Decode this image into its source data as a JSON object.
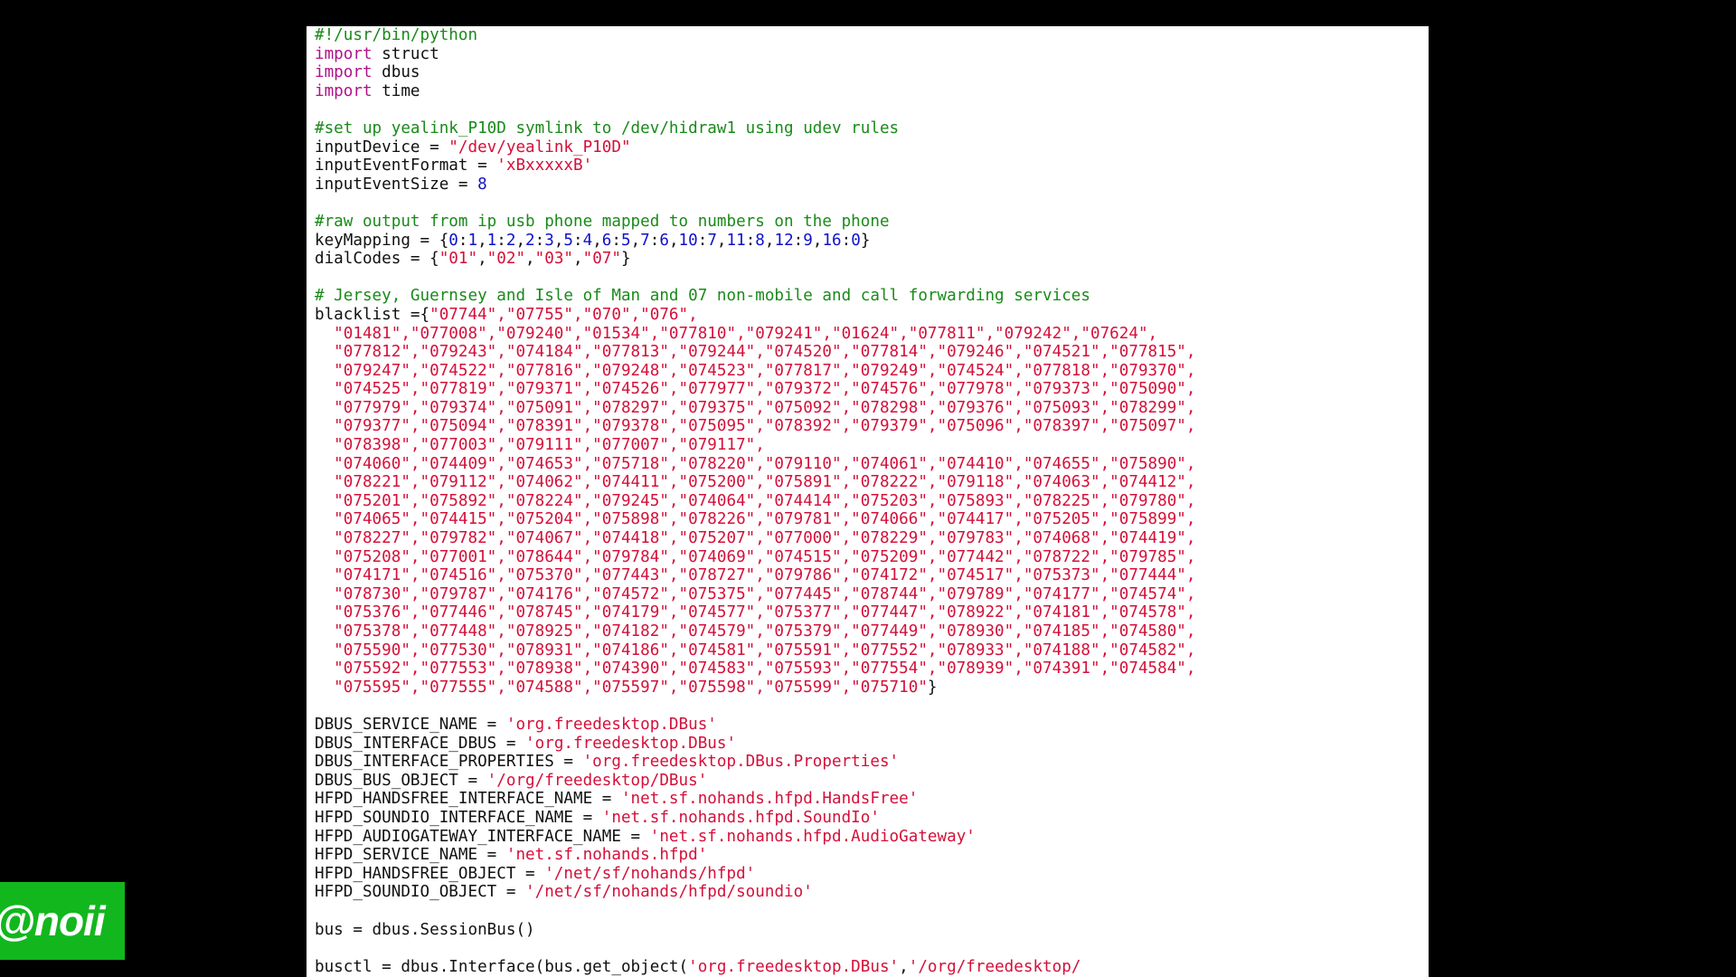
{
  "colors": {
    "background": "#000000",
    "editor_background": "#ffffff",
    "comment": "#1a8a1a",
    "keyword": "#b0128a",
    "string": "#d4103a",
    "number": "#1111c8",
    "plain": "#111111",
    "watermark_background": "#12b71e"
  },
  "watermark": {
    "text": "@noii"
  },
  "editor": {
    "language": "python",
    "lines": [
      [
        {
          "t": "comment",
          "v": "#!/usr/bin/python"
        }
      ],
      [
        {
          "t": "keyword",
          "v": "import"
        },
        {
          "t": "plain",
          "v": " struct"
        }
      ],
      [
        {
          "t": "keyword",
          "v": "import"
        },
        {
          "t": "plain",
          "v": " dbus"
        }
      ],
      [
        {
          "t": "keyword",
          "v": "import"
        },
        {
          "t": "plain",
          "v": " time"
        }
      ],
      [],
      [
        {
          "t": "comment",
          "v": "#set up yealink_P10D symlink to /dev/hidraw1 using udev rules"
        }
      ],
      [
        {
          "t": "plain",
          "v": "inputDevice = "
        },
        {
          "t": "string",
          "v": "\"/dev/yealink_P10D\""
        }
      ],
      [
        {
          "t": "plain",
          "v": "inputEventFormat = "
        },
        {
          "t": "string",
          "v": "'xBxxxxxB'"
        }
      ],
      [
        {
          "t": "plain",
          "v": "inputEventSize = "
        },
        {
          "t": "number",
          "v": "8"
        }
      ],
      [],
      [
        {
          "t": "comment",
          "v": "#raw output from ip usb phone mapped to numbers on the phone"
        }
      ],
      [
        {
          "t": "plain",
          "v": "keyMapping = {"
        },
        {
          "t": "number",
          "v": "0"
        },
        {
          "t": "plain",
          "v": ":"
        },
        {
          "t": "number",
          "v": "1"
        },
        {
          "t": "plain",
          "v": ","
        },
        {
          "t": "number",
          "v": "1"
        },
        {
          "t": "plain",
          "v": ":"
        },
        {
          "t": "number",
          "v": "2"
        },
        {
          "t": "plain",
          "v": ","
        },
        {
          "t": "number",
          "v": "2"
        },
        {
          "t": "plain",
          "v": ":"
        },
        {
          "t": "number",
          "v": "3"
        },
        {
          "t": "plain",
          "v": ","
        },
        {
          "t": "number",
          "v": "5"
        },
        {
          "t": "plain",
          "v": ":"
        },
        {
          "t": "number",
          "v": "4"
        },
        {
          "t": "plain",
          "v": ","
        },
        {
          "t": "number",
          "v": "6"
        },
        {
          "t": "plain",
          "v": ":"
        },
        {
          "t": "number",
          "v": "5"
        },
        {
          "t": "plain",
          "v": ","
        },
        {
          "t": "number",
          "v": "7"
        },
        {
          "t": "plain",
          "v": ":"
        },
        {
          "t": "number",
          "v": "6"
        },
        {
          "t": "plain",
          "v": ","
        },
        {
          "t": "number",
          "v": "10"
        },
        {
          "t": "plain",
          "v": ":"
        },
        {
          "t": "number",
          "v": "7"
        },
        {
          "t": "plain",
          "v": ","
        },
        {
          "t": "number",
          "v": "11"
        },
        {
          "t": "plain",
          "v": ":"
        },
        {
          "t": "number",
          "v": "8"
        },
        {
          "t": "plain",
          "v": ","
        },
        {
          "t": "number",
          "v": "12"
        },
        {
          "t": "plain",
          "v": ":"
        },
        {
          "t": "number",
          "v": "9"
        },
        {
          "t": "plain",
          "v": ","
        },
        {
          "t": "number",
          "v": "16"
        },
        {
          "t": "plain",
          "v": ":"
        },
        {
          "t": "number",
          "v": "0"
        },
        {
          "t": "plain",
          "v": "}"
        }
      ],
      [
        {
          "t": "plain",
          "v": "dialCodes = {"
        },
        {
          "t": "string",
          "v": "\"01\""
        },
        {
          "t": "plain",
          "v": ","
        },
        {
          "t": "string",
          "v": "\"02\""
        },
        {
          "t": "plain",
          "v": ","
        },
        {
          "t": "string",
          "v": "\"03\""
        },
        {
          "t": "plain",
          "v": ","
        },
        {
          "t": "string",
          "v": "\"07\""
        },
        {
          "t": "plain",
          "v": "}"
        }
      ],
      [],
      [
        {
          "t": "comment",
          "v": "# Jersey, Guernsey and Isle of Man and 07 non-mobile and call forwarding services"
        }
      ],
      [
        {
          "t": "plain",
          "v": "blacklist ={"
        },
        {
          "t": "string",
          "v": "\"07744\",\"07755\",\"070\",\"076\","
        }
      ],
      [
        {
          "t": "string",
          "v": "  \"01481\",\"077008\",\"079240\",\"01534\",\"077810\",\"079241\",\"01624\",\"077811\",\"079242\",\"07624\","
        }
      ],
      [
        {
          "t": "string",
          "v": "  \"077812\",\"079243\",\"074184\",\"077813\",\"079244\",\"074520\",\"077814\",\"079246\",\"074521\",\"077815\","
        }
      ],
      [
        {
          "t": "string",
          "v": "  \"079247\",\"074522\",\"077816\",\"079248\",\"074523\",\"077817\",\"079249\",\"074524\",\"077818\",\"079370\","
        }
      ],
      [
        {
          "t": "string",
          "v": "  \"074525\",\"077819\",\"079371\",\"074526\",\"077977\",\"079372\",\"074576\",\"077978\",\"079373\",\"075090\","
        }
      ],
      [
        {
          "t": "string",
          "v": "  \"077979\",\"079374\",\"075091\",\"078297\",\"079375\",\"075092\",\"078298\",\"079376\",\"075093\",\"078299\","
        }
      ],
      [
        {
          "t": "string",
          "v": "  \"079377\",\"075094\",\"078391\",\"079378\",\"075095\",\"078392\",\"079379\",\"075096\",\"078397\",\"075097\","
        }
      ],
      [
        {
          "t": "string",
          "v": "  \"078398\",\"077003\",\"079111\",\"077007\",\"079117\","
        }
      ],
      [
        {
          "t": "string",
          "v": "  \"074060\",\"074409\",\"074653\",\"075718\",\"078220\",\"079110\",\"074061\",\"074410\",\"074655\",\"075890\","
        }
      ],
      [
        {
          "t": "string",
          "v": "  \"078221\",\"079112\",\"074062\",\"074411\",\"075200\",\"075891\",\"078222\",\"079118\",\"074063\",\"074412\","
        }
      ],
      [
        {
          "t": "string",
          "v": "  \"075201\",\"075892\",\"078224\",\"079245\",\"074064\",\"074414\",\"075203\",\"075893\",\"078225\",\"079780\","
        }
      ],
      [
        {
          "t": "string",
          "v": "  \"074065\",\"074415\",\"075204\",\"075898\",\"078226\",\"079781\",\"074066\",\"074417\",\"075205\",\"075899\","
        }
      ],
      [
        {
          "t": "string",
          "v": "  \"078227\",\"079782\",\"074067\",\"074418\",\"075207\",\"077000\",\"078229\",\"079783\",\"074068\",\"074419\","
        }
      ],
      [
        {
          "t": "string",
          "v": "  \"075208\",\"077001\",\"078644\",\"079784\",\"074069\",\"074515\",\"075209\",\"077442\",\"078722\",\"079785\","
        }
      ],
      [
        {
          "t": "string",
          "v": "  \"074171\",\"074516\",\"075370\",\"077443\",\"078727\",\"079786\",\"074172\",\"074517\",\"075373\",\"077444\","
        }
      ],
      [
        {
          "t": "string",
          "v": "  \"078730\",\"079787\",\"074176\",\"074572\",\"075375\",\"077445\",\"078744\",\"079789\",\"074177\",\"074574\","
        }
      ],
      [
        {
          "t": "string",
          "v": "  \"075376\",\"077446\",\"078745\",\"074179\",\"074577\",\"075377\",\"077447\",\"078922\",\"074181\",\"074578\","
        }
      ],
      [
        {
          "t": "string",
          "v": "  \"075378\",\"077448\",\"078925\",\"074182\",\"074579\",\"075379\",\"077449\",\"078930\",\"074185\",\"074580\","
        }
      ],
      [
        {
          "t": "string",
          "v": "  \"075590\",\"077530\",\"078931\",\"074186\",\"074581\",\"075591\",\"077552\",\"078933\",\"074188\",\"074582\","
        }
      ],
      [
        {
          "t": "string",
          "v": "  \"075592\",\"077553\",\"078938\",\"074390\",\"074583\",\"075593\",\"077554\",\"078939\",\"074391\",\"074584\","
        }
      ],
      [
        {
          "t": "string",
          "v": "  \"075595\",\"077555\",\"074588\",\"075597\",\"075598\",\"075599\",\"075710\""
        },
        {
          "t": "plain",
          "v": "}"
        }
      ],
      [],
      [
        {
          "t": "plain",
          "v": "DBUS_SERVICE_NAME = "
        },
        {
          "t": "string",
          "v": "'org.freedesktop.DBus'"
        }
      ],
      [
        {
          "t": "plain",
          "v": "DBUS_INTERFACE_DBUS = "
        },
        {
          "t": "string",
          "v": "'org.freedesktop.DBus'"
        }
      ],
      [
        {
          "t": "plain",
          "v": "DBUS_INTERFACE_PROPERTIES = "
        },
        {
          "t": "string",
          "v": "'org.freedesktop.DBus.Properties'"
        }
      ],
      [
        {
          "t": "plain",
          "v": "DBUS_BUS_OBJECT = "
        },
        {
          "t": "string",
          "v": "'/org/freedesktop/DBus'"
        }
      ],
      [
        {
          "t": "plain",
          "v": "HFPD_HANDSFREE_INTERFACE_NAME = "
        },
        {
          "t": "string",
          "v": "'net.sf.nohands.hfpd.HandsFree'"
        }
      ],
      [
        {
          "t": "plain",
          "v": "HFPD_SOUNDIO_INTERFACE_NAME = "
        },
        {
          "t": "string",
          "v": "'net.sf.nohands.hfpd.SoundIo'"
        }
      ],
      [
        {
          "t": "plain",
          "v": "HFPD_AUDIOGATEWAY_INTERFACE_NAME = "
        },
        {
          "t": "string",
          "v": "'net.sf.nohands.hfpd.AudioGateway'"
        }
      ],
      [
        {
          "t": "plain",
          "v": "HFPD_SERVICE_NAME = "
        },
        {
          "t": "string",
          "v": "'net.sf.nohands.hfpd'"
        }
      ],
      [
        {
          "t": "plain",
          "v": "HFPD_HANDSFREE_OBJECT = "
        },
        {
          "t": "string",
          "v": "'/net/sf/nohands/hfpd'"
        }
      ],
      [
        {
          "t": "plain",
          "v": "HFPD_SOUNDIO_OBJECT = "
        },
        {
          "t": "string",
          "v": "'/net/sf/nohands/hfpd/soundio'"
        }
      ],
      [],
      [
        {
          "t": "plain",
          "v": "bus = dbus.SessionBus()"
        }
      ],
      [],
      [
        {
          "t": "plain",
          "v": "busctl = dbus.Interface(bus.get_object("
        },
        {
          "t": "string",
          "v": "'org.freedesktop.DBus'"
        },
        {
          "t": "plain",
          "v": ","
        },
        {
          "t": "string",
          "v": "'/org/freedesktop/"
        }
      ]
    ]
  }
}
